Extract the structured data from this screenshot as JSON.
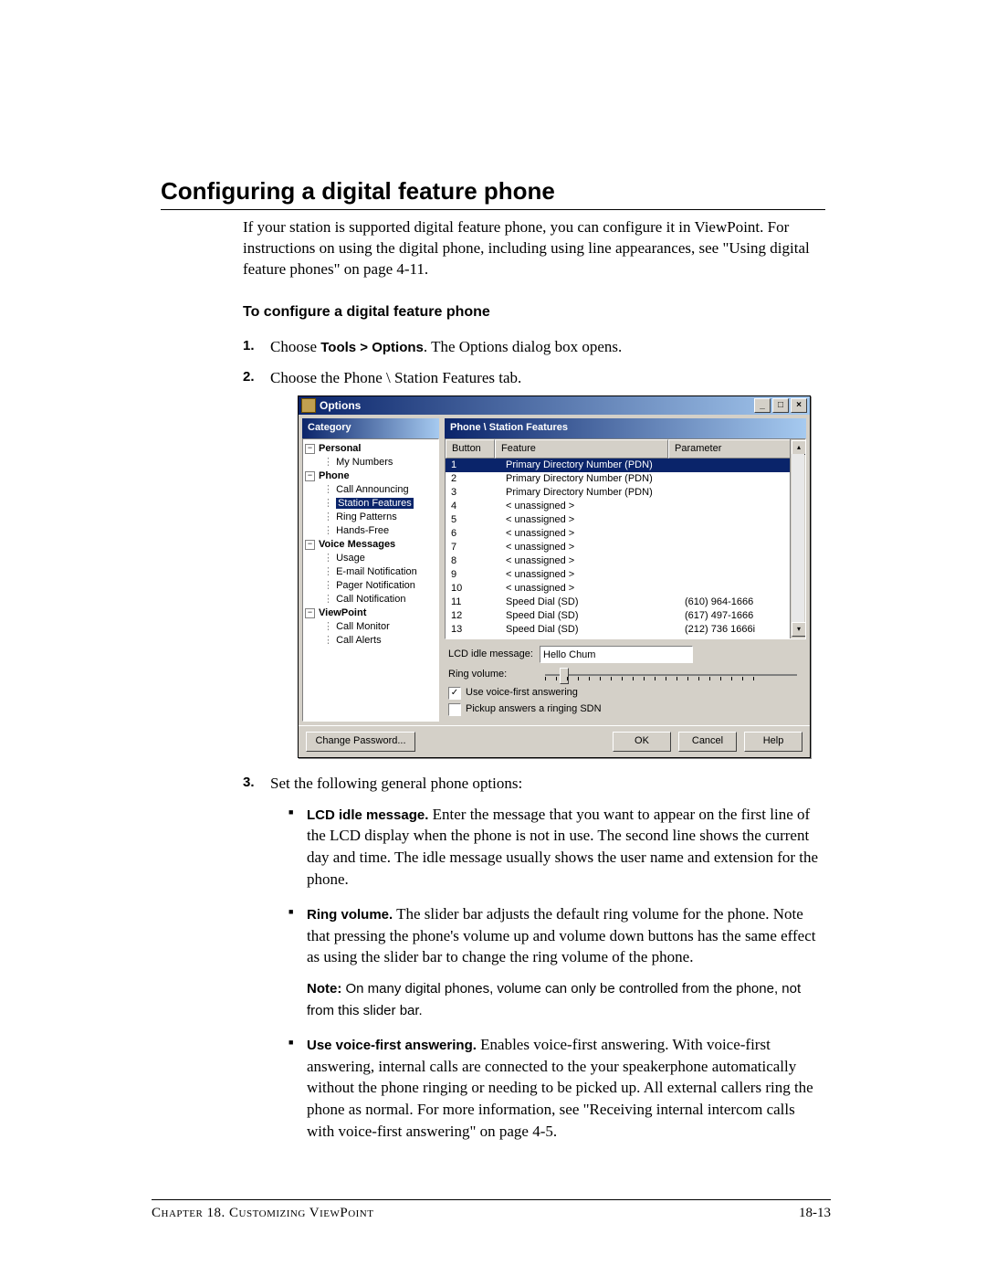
{
  "heading": "Configuring a digital feature phone",
  "intro": "If your station is supported digital feature phone, you can configure it in ViewPoint. For instructions on using the digital phone, including using line appearances, see \"Using digital feature phones\" on page 4-11.",
  "subhead": "To configure a digital feature phone",
  "steps": {
    "s1_pre": "Choose ",
    "s1_bold": "Tools > Options",
    "s1_post": ". The Options dialog box opens.",
    "s2": "Choose the Phone \\ Station Features tab.",
    "s3": "Set the following general phone options:"
  },
  "bullets": {
    "lcd_b": "LCD idle message.",
    "lcd_t": " Enter the message that you want to appear on the first line of the LCD display when the phone is not in use. The second line shows the current day and time. The idle message usually shows the user name and extension for the phone.",
    "ring_b": "Ring volume.",
    "ring_t": " The slider bar adjusts the default ring volume for the phone. Note that pressing the phone's volume up and volume down buttons has the same effect as using the slider bar to change the ring volume of the phone.",
    "note_b": "Note:",
    "note_t": " On many digital phones, volume can only be controlled from the phone, not from this slider bar.",
    "vfa_b": "Use voice-first answering.",
    "vfa_t": " Enables voice-first answering.  With voice-first answering, internal calls are connected to the your speakerphone automatically without the phone ringing or needing to be picked up.  All external callers ring the phone as normal. For more information, see \"Receiving internal intercom calls with voice-first answering\" on page 4-5."
  },
  "dialog": {
    "title": "Options",
    "category_label": "Category",
    "panel_title": "Phone \\ Station Features",
    "tree": {
      "personal": "Personal",
      "my_numbers": "My Numbers",
      "phone": "Phone",
      "call_announcing": "Call Announcing",
      "station_features": "Station Features",
      "ring_patterns": "Ring Patterns",
      "hands_free": "Hands-Free",
      "voice_messages": "Voice Messages",
      "usage": "Usage",
      "email_notification": "E-mail Notification",
      "pager_notification": "Pager Notification",
      "call_notification": "Call Notification",
      "viewpoint": "ViewPoint",
      "call_monitor": "Call Monitor",
      "call_alerts": "Call Alerts"
    },
    "columns": {
      "button": "Button",
      "feature": "Feature",
      "parameter": "Parameter"
    },
    "rows": [
      {
        "b": "1",
        "f": "Primary Directory Number (PDN)",
        "p": ""
      },
      {
        "b": "2",
        "f": "Primary Directory Number (PDN)",
        "p": ""
      },
      {
        "b": "3",
        "f": "Primary Directory Number (PDN)",
        "p": ""
      },
      {
        "b": "4",
        "f": "< unassigned >",
        "p": ""
      },
      {
        "b": "5",
        "f": "< unassigned >",
        "p": ""
      },
      {
        "b": "6",
        "f": "< unassigned >",
        "p": ""
      },
      {
        "b": "7",
        "f": "< unassigned >",
        "p": ""
      },
      {
        "b": "8",
        "f": "< unassigned >",
        "p": ""
      },
      {
        "b": "9",
        "f": "< unassigned >",
        "p": ""
      },
      {
        "b": "10",
        "f": "< unassigned >",
        "p": ""
      },
      {
        "b": "11",
        "f": "Speed Dial (SD)",
        "p": "(610) 964-1666"
      },
      {
        "b": "12",
        "f": "Speed Dial (SD)",
        "p": "(617) 497-1666"
      },
      {
        "b": "13",
        "f": "Speed Dial (SD)",
        "p": "(212) 736 1666i"
      }
    ],
    "lcd_label": "LCD idle message:",
    "lcd_value": "Hello Chum",
    "ring_label": "Ring volume:",
    "chk1": "Use voice-first answering",
    "chk2": "Pickup answers a ringing SDN",
    "change_pw": "Change Password...",
    "ok": "OK",
    "cancel": "Cancel",
    "help": "Help"
  },
  "footer": {
    "left": "Chapter 18. Customizing ViewPoint",
    "right": "18-13"
  }
}
